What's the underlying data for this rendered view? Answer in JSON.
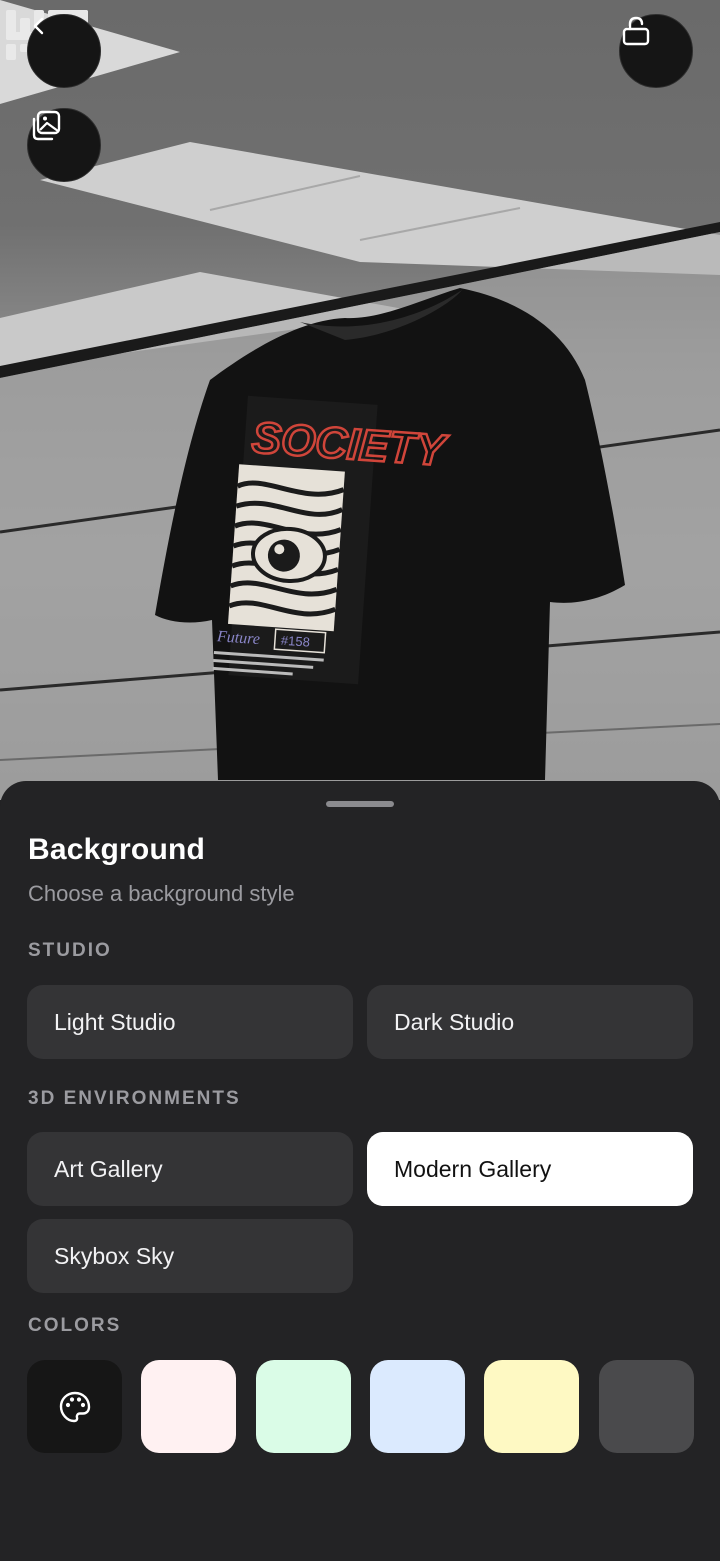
{
  "header": {
    "back_icon": "chevron-left-icon",
    "background_picker_icon": "images-icon",
    "lock_icon": "unlock-icon",
    "logo_name": "w3d-logo"
  },
  "preview": {
    "shirt_print_title": "SOCIETY",
    "shirt_print_tag": "#158",
    "shirt_print_script": "Future"
  },
  "sheet": {
    "title": "Background",
    "subtitle": "Choose a background style",
    "sections": {
      "studio": {
        "label": "STUDIO",
        "options": [
          "Light Studio",
          "Dark Studio"
        ]
      },
      "environments": {
        "label": "3D ENVIRONMENTS",
        "options": [
          "Art Gallery",
          "Modern Gallery",
          "Skybox Sky"
        ],
        "selected": "Modern Gallery"
      },
      "colors": {
        "label": "COLORS",
        "custom_icon": "palette-icon",
        "swatches": [
          "#FFF1F2",
          "#DAFCE7",
          "#DBEAFE",
          "#FEF9C3",
          "#4A4A4C"
        ]
      }
    }
  }
}
